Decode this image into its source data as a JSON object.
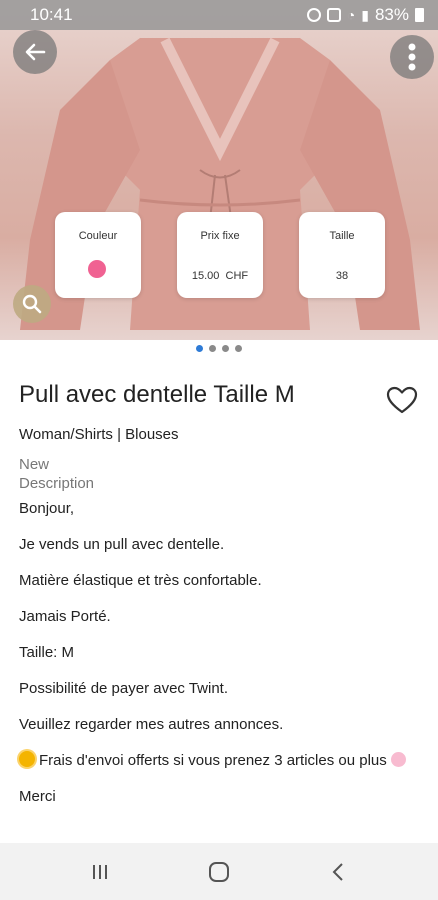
{
  "status_bar": {
    "time": "10:41",
    "battery": "83%",
    "icons": [
      "alarm-icon",
      "lock-icon",
      "wifi-icon",
      "signal-icon",
      "battery-icon"
    ]
  },
  "hero": {
    "cards": {
      "color": {
        "label": "Couleur",
        "swatch": "#f06292"
      },
      "price": {
        "label": "Prix fixe",
        "value": "15.00  CHF"
      },
      "size": {
        "label": "Taille",
        "value": "38"
      }
    },
    "pager": {
      "count": 4,
      "active": 0
    }
  },
  "product": {
    "title": "Pull avec dentelle Taille M",
    "category": "Woman/Shirts | Blouses",
    "condition": "New",
    "description_label": "Description",
    "description": [
      "Bonjour,",
      "Je vends un pull avec dentelle.",
      "Matière élastique et très confortable.",
      "Jamais Porté.",
      "Taille: M",
      "Possibilité de payer avec Twint.",
      "Veuillez regarder mes autres annonces.",
      "Frais d'envoi offerts si vous prenez 3 articles ou plus",
      "Merci"
    ]
  },
  "colors": {
    "accent": "#2e7bd6",
    "swatch": "#f06292"
  }
}
